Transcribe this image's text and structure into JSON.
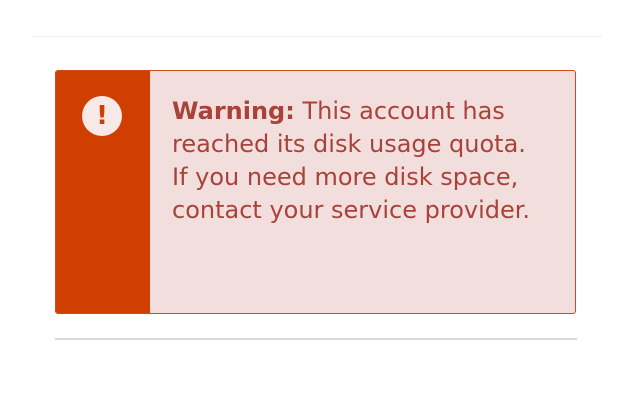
{
  "alert": {
    "label": "Warning:",
    "message": "This account has reached its disk usage quota. If you need more disk space, contact your service provider.",
    "icon": "exclamation-circle-icon",
    "icon_glyph": "!",
    "colors": {
      "stripe": "#d13f00",
      "background": "#f3dede",
      "text": "#a8433a",
      "border": "#d24a1c"
    }
  }
}
